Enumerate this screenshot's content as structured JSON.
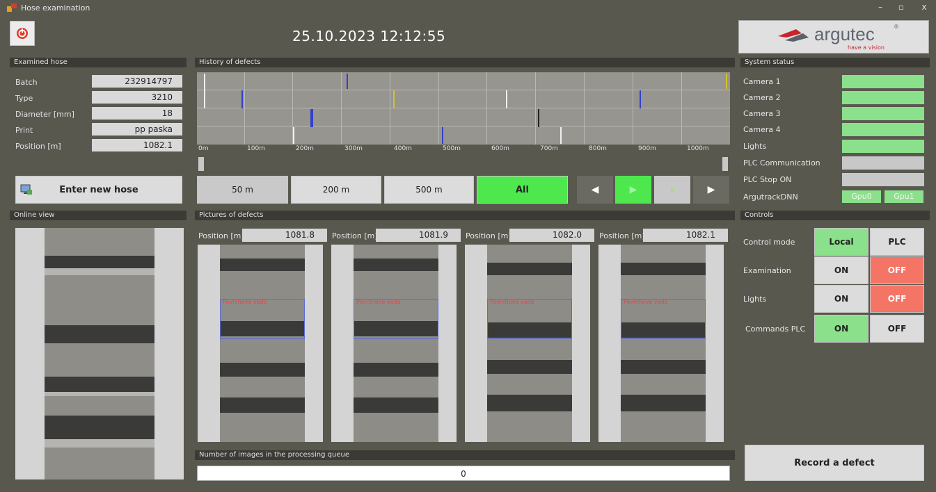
{
  "window": {
    "title": "Hose examination",
    "minimize": "–",
    "restore": "▫",
    "close": "x"
  },
  "header": {
    "datetime": "25.10.2023 12:12:55",
    "logo_text": "argutec",
    "logo_reg": "®",
    "logo_tagline": "have a vision"
  },
  "examined_hose": {
    "title": "Examined hose",
    "fields": [
      {
        "label": "Batch",
        "value": "232914797"
      },
      {
        "label": "Type",
        "value": "3210"
      },
      {
        "label": "Diameter [mm]",
        "value": "18"
      },
      {
        "label": "Print",
        "value": "pp paska"
      },
      {
        "label": "Position [m]",
        "value": "1082.1"
      }
    ],
    "enter_button": "Enter new hose"
  },
  "history": {
    "title": "History of defects",
    "axis": [
      "0m",
      "100m",
      "200m",
      "300m",
      "400m",
      "500m",
      "600m",
      "700m",
      "800m",
      "900m",
      "1000m"
    ],
    "range_buttons": [
      "50 m",
      "200 m",
      "500 m",
      "All"
    ],
    "nav": [
      "◀",
      "▶",
      "⏸",
      "▶"
    ]
  },
  "system_status": {
    "title": "System status",
    "items": [
      {
        "label": "Camera 1",
        "state": "ok"
      },
      {
        "label": "Camera 2",
        "state": "ok"
      },
      {
        "label": "Camera 3",
        "state": "ok"
      },
      {
        "label": "Camera 4",
        "state": "ok"
      },
      {
        "label": "Lights",
        "state": "ok"
      },
      {
        "label": "PLC Communication",
        "state": "off"
      },
      {
        "label": "PLC  Stop ON",
        "state": "off"
      }
    ],
    "dnn_label": "ArgutrackDNN",
    "gpus": [
      "Gpu0",
      "Gpu1"
    ]
  },
  "online_view": {
    "title": "Online view"
  },
  "pictures": {
    "title": "Pictures of defects",
    "position_label": "Position [m]",
    "positions": [
      "1081.8",
      "1081.9",
      "1082.0",
      "1082.1"
    ],
    "defect_label": "Povrchova vada"
  },
  "queue": {
    "title": "Number of images in the processing queue",
    "value": "0"
  },
  "controls": {
    "title": "Controls",
    "rows": [
      {
        "label": "Control mode",
        "a": "Local",
        "b": "PLC"
      },
      {
        "label": "Examination",
        "a": "ON",
        "b": "OFF"
      },
      {
        "label": "Lights",
        "a": "ON",
        "b": "OFF"
      },
      {
        "label": "Commands PLC",
        "a": "ON",
        "b": "OFF"
      }
    ],
    "record_button": "Record a defect"
  },
  "colors": {
    "ok": "#8be08b",
    "off": "#c8c8c8",
    "accent_green": "#4ee84e",
    "off_red": "#f47466"
  }
}
